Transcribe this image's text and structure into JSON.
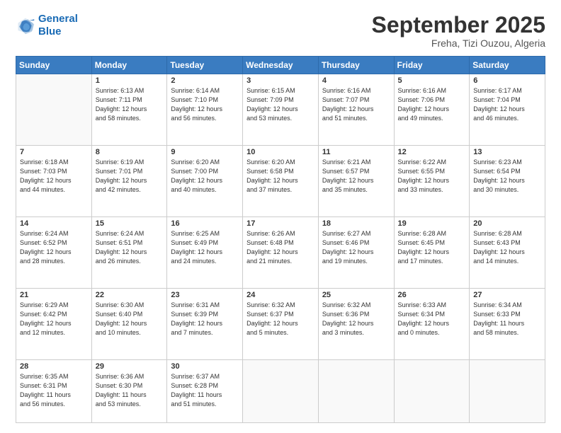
{
  "logo": {
    "line1": "General",
    "line2": "Blue"
  },
  "header": {
    "month": "September 2025",
    "location": "Freha, Tizi Ouzou, Algeria"
  },
  "weekdays": [
    "Sunday",
    "Monday",
    "Tuesday",
    "Wednesday",
    "Thursday",
    "Friday",
    "Saturday"
  ],
  "weeks": [
    [
      {
        "day": "",
        "sunrise": "",
        "sunset": "",
        "daylight": ""
      },
      {
        "day": "1",
        "sunrise": "Sunrise: 6:13 AM",
        "sunset": "Sunset: 7:11 PM",
        "daylight": "Daylight: 12 hours and 58 minutes."
      },
      {
        "day": "2",
        "sunrise": "Sunrise: 6:14 AM",
        "sunset": "Sunset: 7:10 PM",
        "daylight": "Daylight: 12 hours and 56 minutes."
      },
      {
        "day": "3",
        "sunrise": "Sunrise: 6:15 AM",
        "sunset": "Sunset: 7:09 PM",
        "daylight": "Daylight: 12 hours and 53 minutes."
      },
      {
        "day": "4",
        "sunrise": "Sunrise: 6:16 AM",
        "sunset": "Sunset: 7:07 PM",
        "daylight": "Daylight: 12 hours and 51 minutes."
      },
      {
        "day": "5",
        "sunrise": "Sunrise: 6:16 AM",
        "sunset": "Sunset: 7:06 PM",
        "daylight": "Daylight: 12 hours and 49 minutes."
      },
      {
        "day": "6",
        "sunrise": "Sunrise: 6:17 AM",
        "sunset": "Sunset: 7:04 PM",
        "daylight": "Daylight: 12 hours and 46 minutes."
      }
    ],
    [
      {
        "day": "7",
        "sunrise": "Sunrise: 6:18 AM",
        "sunset": "Sunset: 7:03 PM",
        "daylight": "Daylight: 12 hours and 44 minutes."
      },
      {
        "day": "8",
        "sunrise": "Sunrise: 6:19 AM",
        "sunset": "Sunset: 7:01 PM",
        "daylight": "Daylight: 12 hours and 42 minutes."
      },
      {
        "day": "9",
        "sunrise": "Sunrise: 6:20 AM",
        "sunset": "Sunset: 7:00 PM",
        "daylight": "Daylight: 12 hours and 40 minutes."
      },
      {
        "day": "10",
        "sunrise": "Sunrise: 6:20 AM",
        "sunset": "Sunset: 6:58 PM",
        "daylight": "Daylight: 12 hours and 37 minutes."
      },
      {
        "day": "11",
        "sunrise": "Sunrise: 6:21 AM",
        "sunset": "Sunset: 6:57 PM",
        "daylight": "Daylight: 12 hours and 35 minutes."
      },
      {
        "day": "12",
        "sunrise": "Sunrise: 6:22 AM",
        "sunset": "Sunset: 6:55 PM",
        "daylight": "Daylight: 12 hours and 33 minutes."
      },
      {
        "day": "13",
        "sunrise": "Sunrise: 6:23 AM",
        "sunset": "Sunset: 6:54 PM",
        "daylight": "Daylight: 12 hours and 30 minutes."
      }
    ],
    [
      {
        "day": "14",
        "sunrise": "Sunrise: 6:24 AM",
        "sunset": "Sunset: 6:52 PM",
        "daylight": "Daylight: 12 hours and 28 minutes."
      },
      {
        "day": "15",
        "sunrise": "Sunrise: 6:24 AM",
        "sunset": "Sunset: 6:51 PM",
        "daylight": "Daylight: 12 hours and 26 minutes."
      },
      {
        "day": "16",
        "sunrise": "Sunrise: 6:25 AM",
        "sunset": "Sunset: 6:49 PM",
        "daylight": "Daylight: 12 hours and 24 minutes."
      },
      {
        "day": "17",
        "sunrise": "Sunrise: 6:26 AM",
        "sunset": "Sunset: 6:48 PM",
        "daylight": "Daylight: 12 hours and 21 minutes."
      },
      {
        "day": "18",
        "sunrise": "Sunrise: 6:27 AM",
        "sunset": "Sunset: 6:46 PM",
        "daylight": "Daylight: 12 hours and 19 minutes."
      },
      {
        "day": "19",
        "sunrise": "Sunrise: 6:28 AM",
        "sunset": "Sunset: 6:45 PM",
        "daylight": "Daylight: 12 hours and 17 minutes."
      },
      {
        "day": "20",
        "sunrise": "Sunrise: 6:28 AM",
        "sunset": "Sunset: 6:43 PM",
        "daylight": "Daylight: 12 hours and 14 minutes."
      }
    ],
    [
      {
        "day": "21",
        "sunrise": "Sunrise: 6:29 AM",
        "sunset": "Sunset: 6:42 PM",
        "daylight": "Daylight: 12 hours and 12 minutes."
      },
      {
        "day": "22",
        "sunrise": "Sunrise: 6:30 AM",
        "sunset": "Sunset: 6:40 PM",
        "daylight": "Daylight: 12 hours and 10 minutes."
      },
      {
        "day": "23",
        "sunrise": "Sunrise: 6:31 AM",
        "sunset": "Sunset: 6:39 PM",
        "daylight": "Daylight: 12 hours and 7 minutes."
      },
      {
        "day": "24",
        "sunrise": "Sunrise: 6:32 AM",
        "sunset": "Sunset: 6:37 PM",
        "daylight": "Daylight: 12 hours and 5 minutes."
      },
      {
        "day": "25",
        "sunrise": "Sunrise: 6:32 AM",
        "sunset": "Sunset: 6:36 PM",
        "daylight": "Daylight: 12 hours and 3 minutes."
      },
      {
        "day": "26",
        "sunrise": "Sunrise: 6:33 AM",
        "sunset": "Sunset: 6:34 PM",
        "daylight": "Daylight: 12 hours and 0 minutes."
      },
      {
        "day": "27",
        "sunrise": "Sunrise: 6:34 AM",
        "sunset": "Sunset: 6:33 PM",
        "daylight": "Daylight: 11 hours and 58 minutes."
      }
    ],
    [
      {
        "day": "28",
        "sunrise": "Sunrise: 6:35 AM",
        "sunset": "Sunset: 6:31 PM",
        "daylight": "Daylight: 11 hours and 56 minutes."
      },
      {
        "day": "29",
        "sunrise": "Sunrise: 6:36 AM",
        "sunset": "Sunset: 6:30 PM",
        "daylight": "Daylight: 11 hours and 53 minutes."
      },
      {
        "day": "30",
        "sunrise": "Sunrise: 6:37 AM",
        "sunset": "Sunset: 6:28 PM",
        "daylight": "Daylight: 11 hours and 51 minutes."
      },
      {
        "day": "",
        "sunrise": "",
        "sunset": "",
        "daylight": ""
      },
      {
        "day": "",
        "sunrise": "",
        "sunset": "",
        "daylight": ""
      },
      {
        "day": "",
        "sunrise": "",
        "sunset": "",
        "daylight": ""
      },
      {
        "day": "",
        "sunrise": "",
        "sunset": "",
        "daylight": ""
      }
    ]
  ]
}
